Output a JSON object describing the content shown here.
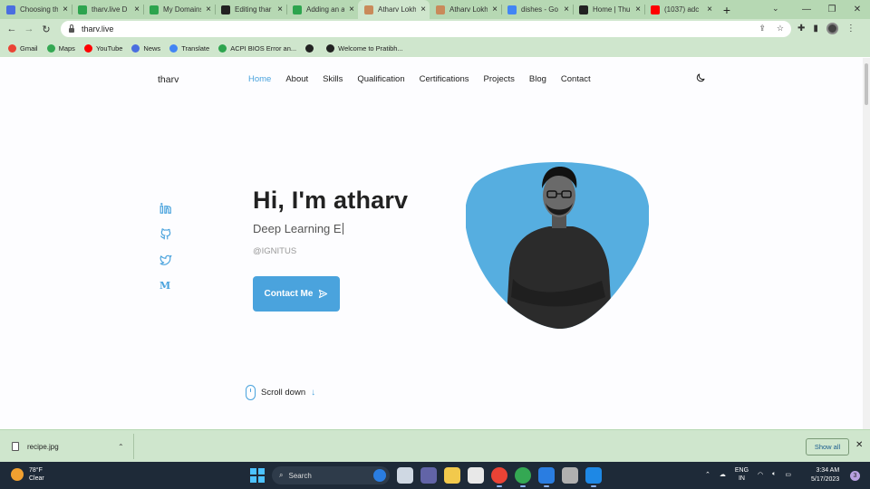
{
  "browser": {
    "tabs": [
      {
        "title": "Choosing th",
        "favicon_color": "#4a6ee0",
        "favicon_icon": "doc-icon"
      },
      {
        "title": "tharv.live D",
        "favicon_color": "#2da44e",
        "favicon_icon": "n-icon"
      },
      {
        "title": "My Domains",
        "favicon_color": "#2da44e",
        "favicon_icon": "n-icon"
      },
      {
        "title": "Editing thar",
        "favicon_color": "#222222",
        "favicon_icon": "github-icon"
      },
      {
        "title": "Adding an a",
        "favicon_color": "#2da44e",
        "favicon_icon": "n-icon"
      },
      {
        "title": "Atharv Lokh",
        "favicon_color": "#c98a5a",
        "favicon_icon": "avatar-icon",
        "active": true
      },
      {
        "title": "Atharv Lokh",
        "favicon_color": "#c98a5a",
        "favicon_icon": "avatar-icon"
      },
      {
        "title": "dishes - Go",
        "favicon_color": "#4285f4",
        "favicon_icon": "google-icon"
      },
      {
        "title": "Home | Thu",
        "favicon_color": "#222222",
        "favicon_icon": "wix-icon"
      },
      {
        "title": "(1037) adc",
        "favicon_color": "#ff0000",
        "favicon_icon": "youtube-icon"
      }
    ],
    "new_tab_label": "+",
    "url": "tharv.live",
    "bookmarks": [
      {
        "label": "Gmail",
        "color": "#ea4335"
      },
      {
        "label": "Maps",
        "color": "#34a853"
      },
      {
        "label": "YouTube",
        "color": "#ff0000"
      },
      {
        "label": "News",
        "color": "#4a6ee0"
      },
      {
        "label": "Translate",
        "color": "#4285f4"
      },
      {
        "label": "ACPI BIOS Error an...",
        "color": "#2da44e"
      },
      {
        "label": "",
        "color": "#222222"
      },
      {
        "label": "Welcome to Pratibh...",
        "color": "#222222"
      }
    ]
  },
  "site": {
    "logo": "tharv",
    "nav": [
      {
        "label": "Home",
        "active": true
      },
      {
        "label": "About"
      },
      {
        "label": "Skills"
      },
      {
        "label": "Qualification"
      },
      {
        "label": "Certifications"
      },
      {
        "label": "Projects"
      },
      {
        "label": "Blog"
      },
      {
        "label": "Contact"
      }
    ],
    "accent_color": "#4aa3dd",
    "social_icons": [
      "linkedin-icon",
      "github-icon",
      "twitter-icon",
      "medium-icon"
    ],
    "heading": "Hi, I'm atharv",
    "subtitle": "Deep Learning E",
    "handle": "@IGNITUS",
    "contact_button": "Contact Me",
    "scroll_down": "Scroll down"
  },
  "downloads": {
    "file": "recipe.jpg",
    "show_all": "Show all"
  },
  "taskbar": {
    "temperature": "78°F",
    "weather": "Clear",
    "search_placeholder": "Search",
    "lang_line1": "ENG",
    "lang_line2": "IN",
    "time": "3:34 AM",
    "date": "5/17/2023",
    "notification_count": "3"
  }
}
